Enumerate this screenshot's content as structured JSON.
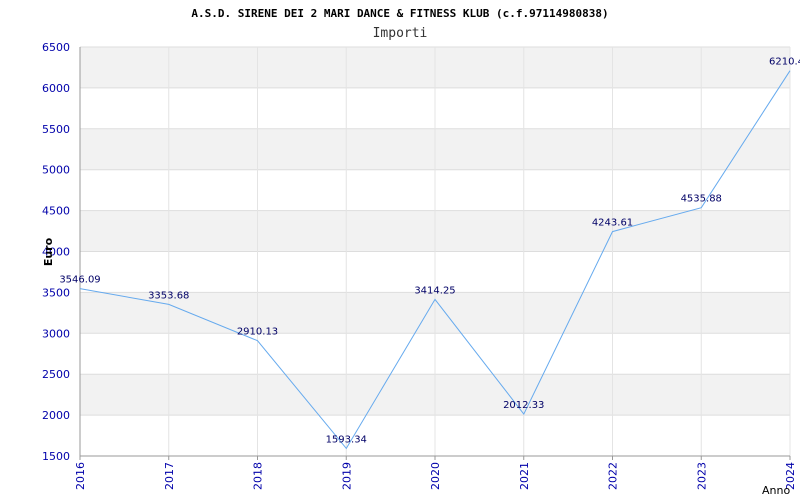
{
  "chart_data": {
    "type": "line",
    "title": "A.S.D. SIRENE DEI 2 MARI DANCE & FITNESS KLUB (c.f.97114980838)",
    "subtitle": "Importi",
    "xlabel": "Anno",
    "ylabel": "Euro",
    "x": [
      "2016",
      "2017",
      "2018",
      "2019",
      "2020",
      "2021",
      "2022",
      "2023",
      "2024"
    ],
    "series": [
      {
        "values": [
          3546.09,
          3353.68,
          2910.13,
          1593.34,
          3414.25,
          2012.33,
          4243.61,
          4535.88,
          6210.4
        ]
      }
    ],
    "data_labels": [
      "3546.09",
      "3353.68",
      "2910.13",
      "1593.34",
      "3414.25",
      "2012.33",
      "4243.61",
      "4535.88",
      "6210.4"
    ],
    "y_ticks": [
      "1500",
      "2000",
      "2500",
      "3000",
      "3500",
      "4000",
      "4500",
      "5000",
      "5500",
      "6000",
      "6500"
    ],
    "ylim": [
      1500,
      6500
    ],
    "grid": true,
    "legend": "none",
    "colors": {
      "line": "#66aaee",
      "tick_labels": "#0000aa",
      "data_labels": "#000066",
      "band": "#f2f2f2",
      "grid": "#dddddd"
    }
  }
}
